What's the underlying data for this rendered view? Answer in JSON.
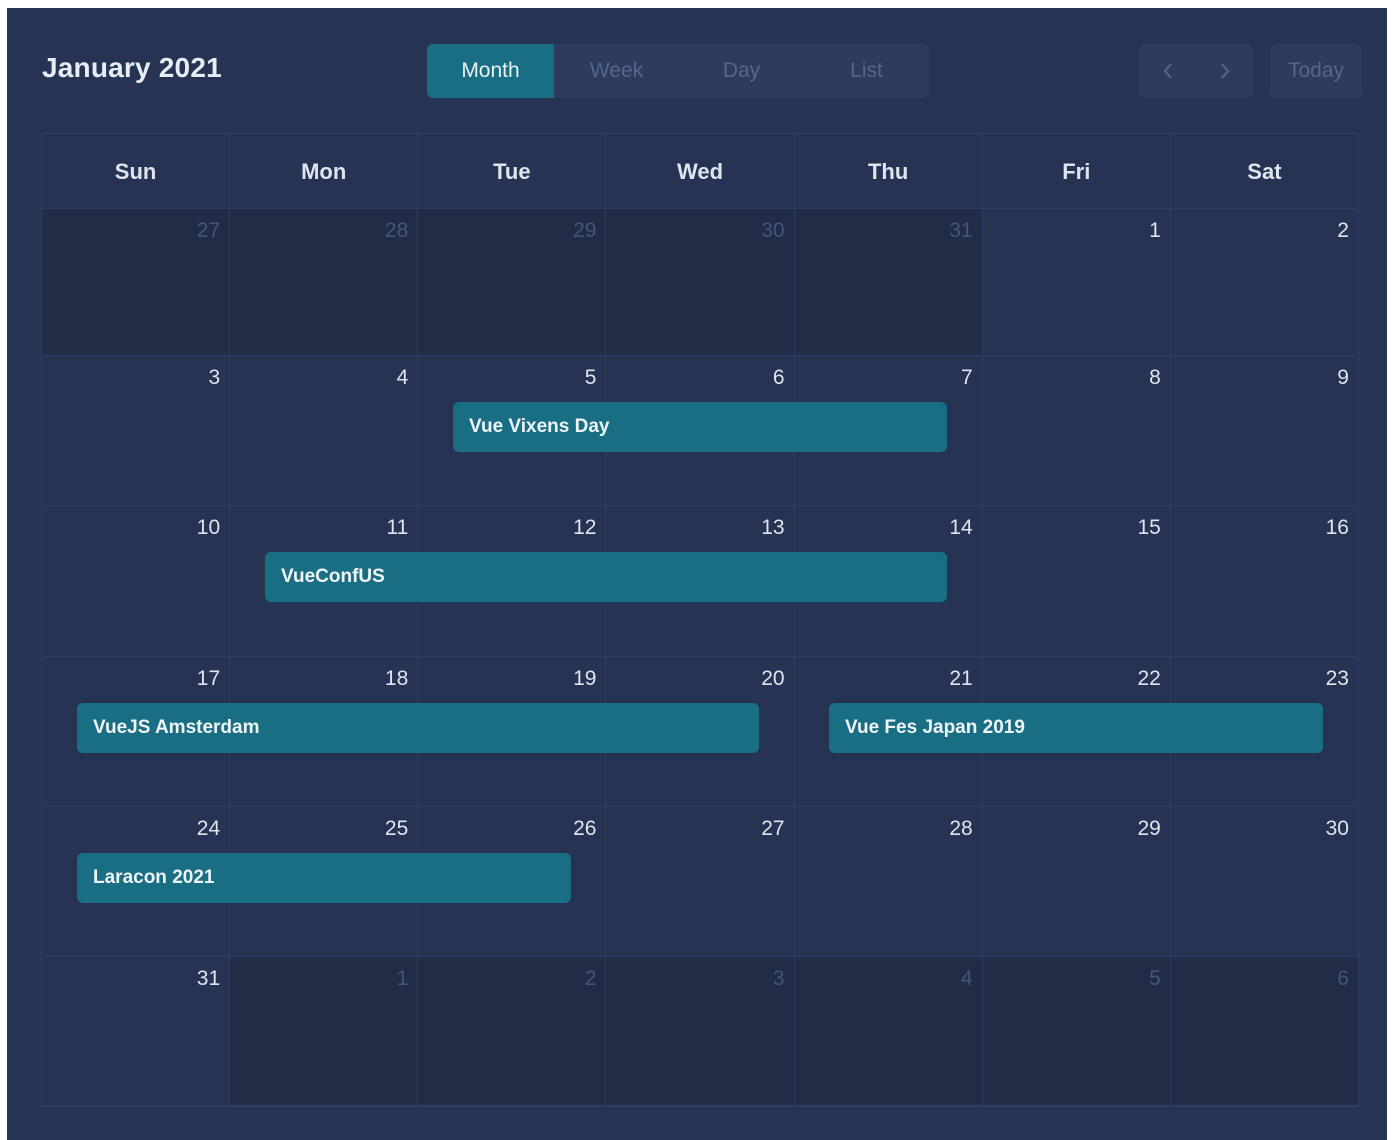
{
  "calendar": {
    "title": "January 2021",
    "views": [
      {
        "label": "Month",
        "active": true
      },
      {
        "label": "Week",
        "active": false
      },
      {
        "label": "Day",
        "active": false
      },
      {
        "label": "List",
        "active": false
      }
    ],
    "today_label": "Today",
    "weekdays": [
      "Sun",
      "Mon",
      "Tue",
      "Wed",
      "Thu",
      "Fri",
      "Sat"
    ],
    "weeks": [
      [
        {
          "d": "27",
          "other": true
        },
        {
          "d": "28",
          "other": true
        },
        {
          "d": "29",
          "other": true
        },
        {
          "d": "30",
          "other": true
        },
        {
          "d": "31",
          "other": true
        },
        {
          "d": "1",
          "other": false
        },
        {
          "d": "2",
          "other": false
        }
      ],
      [
        {
          "d": "3",
          "other": false
        },
        {
          "d": "4",
          "other": false
        },
        {
          "d": "5",
          "other": false
        },
        {
          "d": "6",
          "other": false
        },
        {
          "d": "7",
          "other": false
        },
        {
          "d": "8",
          "other": false
        },
        {
          "d": "9",
          "other": false
        }
      ],
      [
        {
          "d": "10",
          "other": false
        },
        {
          "d": "11",
          "other": false
        },
        {
          "d": "12",
          "other": false
        },
        {
          "d": "13",
          "other": false
        },
        {
          "d": "14",
          "other": false
        },
        {
          "d": "15",
          "other": false
        },
        {
          "d": "16",
          "other": false
        }
      ],
      [
        {
          "d": "17",
          "other": false
        },
        {
          "d": "18",
          "other": false
        },
        {
          "d": "19",
          "other": false
        },
        {
          "d": "20",
          "other": false
        },
        {
          "d": "21",
          "other": false
        },
        {
          "d": "22",
          "other": false
        },
        {
          "d": "23",
          "other": false
        }
      ],
      [
        {
          "d": "24",
          "other": false
        },
        {
          "d": "25",
          "other": false
        },
        {
          "d": "26",
          "other": false
        },
        {
          "d": "27",
          "other": false
        },
        {
          "d": "28",
          "other": false
        },
        {
          "d": "29",
          "other": false
        },
        {
          "d": "30",
          "other": false
        }
      ],
      [
        {
          "d": "31",
          "other": false
        },
        {
          "d": "1",
          "other": true
        },
        {
          "d": "2",
          "other": true
        },
        {
          "d": "3",
          "other": true
        },
        {
          "d": "4",
          "other": true
        },
        {
          "d": "5",
          "other": true
        },
        {
          "d": "6",
          "other": true
        }
      ]
    ],
    "events": [
      {
        "title": "Vue Vixens Day",
        "start": "2021-01-05",
        "end": "2021-01-07"
      },
      {
        "title": "VueConfUS",
        "start": "2021-01-11",
        "end": "2021-01-14"
      },
      {
        "title": "VueJS Amsterdam",
        "start": "2021-01-17",
        "end": "2021-01-20"
      },
      {
        "title": "Vue Fes Japan 2019",
        "start": "2021-01-21",
        "end": "2021-01-23"
      },
      {
        "title": "Laracon 2021",
        "start": "2021-01-24",
        "end": "2021-01-26"
      }
    ]
  },
  "colors": {
    "background": "#263352",
    "other_month": "#212c47",
    "accent": "#1a6e83",
    "grid_line": "#2f3d60"
  }
}
